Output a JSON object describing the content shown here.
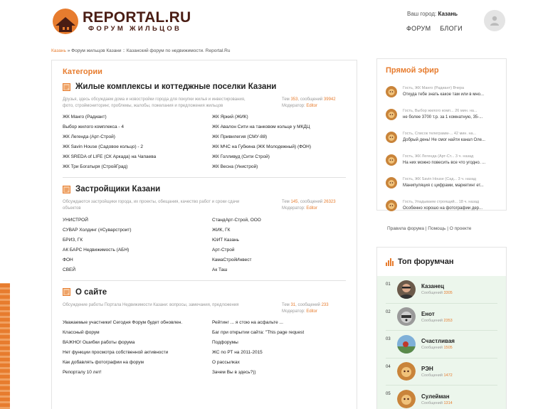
{
  "header": {
    "logo_title": "REPORTAL.RU",
    "logo_subtitle": "ФОРУМ ЖИЛЬЦОВ",
    "city_label": "Ваш город:",
    "city_value": "Казань",
    "nav": [
      "ФОРУМ",
      "БЛОГИ"
    ]
  },
  "breadcrumb": {
    "city": "Казань",
    "separator": "»",
    "page": "Форум жильцов Казани :: Казанский форум по недвижимости. Reportal.Ru"
  },
  "main": {
    "title": "Категории",
    "sections": [
      {
        "title": "Жилые комплексы и коттеджные поселки Казани",
        "description": "Друзья, здесь обсуждаем дома и новостройки города для покупки жилья и инвестирования, фото, строймониторинг, проблемы, жалобы, пожелания и предложения жильцов",
        "stats_prefix": "Тем",
        "topics": "353",
        "messages_prefix": ", сообщений",
        "messages": "39942",
        "moderator_label": "Модератор:",
        "moderator": "Editor",
        "links_left": [
          "ЖК Манго (Радиант)",
          "Выбор жилого комплекса - 4",
          "ЖК Легенда (Арт-Строй)",
          "ЖК Savin House (Садовое кольцо) - 2",
          "ЖК SREDA of LIFE (СК Аркада) на Чапаева",
          "ЖК Три Богатыря (СтройГрад)"
        ],
        "links_right": [
          "ЖК Яркий (ЖИК)",
          "ЖК Авалон Сити на танковом кольце у МКДЦ",
          "ЖК Привилегия (СМУ-88)",
          "ЖК МЧС на Губкина (ЖК Молодежный) (ФОН)",
          "ЖК Голливуд (Сити Строй)",
          "ЖК Весна (Унистрой)"
        ]
      },
      {
        "title": "Застройщики Казани",
        "description": "Обсуждаются застройщики города, их проекты, обещания, качество работ и сроки сдачи объектов",
        "stats_prefix": "Тем",
        "topics": "145",
        "messages_prefix": ", сообщений",
        "messages": "26323",
        "moderator_label": "Модератор:",
        "moderator": "Editor",
        "links_left": [
          "УНИСТРОЙ",
          "СУВАР Холдинг (#Суварстроит)",
          "БРИЗ, ГК",
          "АК БАРС Недвижимость (АБН)",
          "ФОН",
          "СВЕЙ"
        ],
        "links_right": [
          "СтандАрт-Строй, ООО",
          "ЖИК, ГК",
          "ЮИТ Казань",
          "Арт-Строй",
          "КамаСтройИнвест",
          "Ак Таш"
        ]
      },
      {
        "title": "О сайте",
        "description": "Обсуждение работы Портала Недвижимости Казани: вопросы, замечания, предложения",
        "stats_prefix": "Тем",
        "topics": "31",
        "messages_prefix": ", сообщений",
        "messages": "233",
        "moderator_label": "Модератор:",
        "moderator": "Editor",
        "links_left": [
          "Уважаемые участники! Сегодня Форум будет обновлен.",
          "Классный форум",
          "ВАЖНО! Ошибки работы форума",
          "Нет функции просмотра собственной активности",
          "Как добавлять фотографии на форум",
          "Репорталу 10 лет!"
        ],
        "links_right": [
          "Рейтинг ... я стою на асфальте ...",
          "Баг при открытии сайта: \"This page request",
          "Подфорумы",
          "ЖС по РТ на 2011-2015",
          "О рассылках",
          "Зачем Вы в здесь?))"
        ]
      }
    ]
  },
  "live": {
    "title": "Прямой эфир",
    "items": [
      {
        "meta": "Гость, ЖК Манго (Радиант)            Вчера",
        "message": "Откуда тебе знать какое там или в мно..."
      },
      {
        "meta": "Гость, Выбор жилого комп...   26 мин. на...",
        "message": "не более 3700 т.р. за 1 комнатную, 35-..."
      },
      {
        "meta": "Гость, Список телеграмм-...   42 мин. на...",
        "message": "Добрый день! Не смог найти канал Олe..."
      },
      {
        "meta": "Гость, ЖК Легенда (Арт-Ст...    3 ч. назад",
        "message": "На них можно повесить все что угодно. ..."
      },
      {
        "meta": "Гость, ЖК Savin House (Сад...    3 ч. назад",
        "message": "Манипуляция с цифрами, маркетинг ет..."
      },
      {
        "meta": "Гость, Упадываем строящий...   18 ч. назад",
        "message": "Особенно хорошо на фотографии дер..."
      }
    ]
  },
  "footer_links": [
    "Правила форума",
    "Помощь",
    "О проекте"
  ],
  "footer_sep": "|",
  "top_users": {
    "title": "Топ форумчан",
    "count_label": "Сообщений",
    "users": [
      {
        "rank": "01",
        "name": "Казанец",
        "count": "3305"
      },
      {
        "rank": "02",
        "name": "Енот",
        "count": "2353"
      },
      {
        "rank": "03",
        "name": "Счастливая",
        "count": "1505"
      },
      {
        "rank": "04",
        "name": "РЭН",
        "count": "1472"
      },
      {
        "rank": "05",
        "name": "Сулейман",
        "count": "1314"
      }
    ]
  },
  "colors": {
    "accent": "#e77c2e",
    "brand": "#4a1d14",
    "top_bg": "#ecf6ec"
  },
  "icons": {
    "logo": "house-flame-logo",
    "avatar": "user-icon",
    "section": "forum-doc-icon",
    "live_avatar": "lion-avatar",
    "top": "bar-chart-icon"
  }
}
